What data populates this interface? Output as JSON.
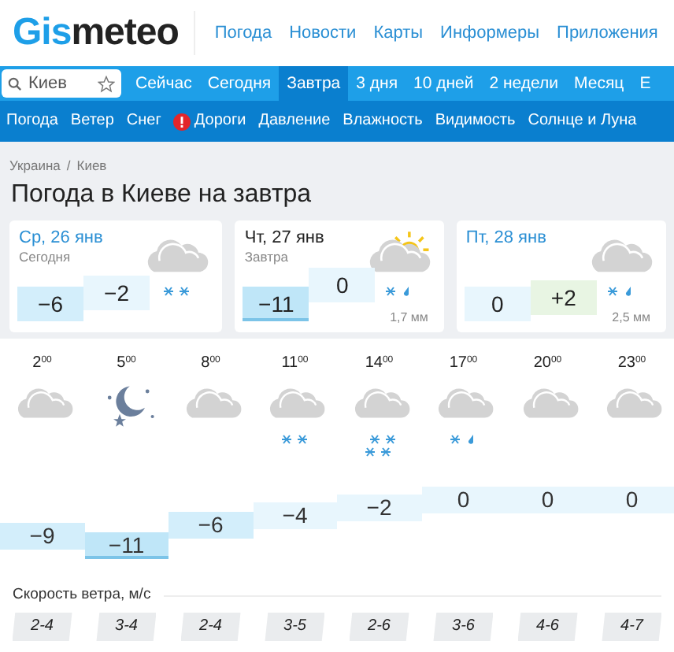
{
  "logo": {
    "part_1": "Gis",
    "part_2": "meteo"
  },
  "top_nav": [
    "Погода",
    "Новости",
    "Карты",
    "Информеры",
    "Приложения"
  ],
  "search": {
    "value": "Киев"
  },
  "period_tabs": [
    {
      "label": "Сейчас",
      "selected": false
    },
    {
      "label": "Сегодня",
      "selected": false
    },
    {
      "label": "Завтра",
      "selected": true
    },
    {
      "label": "3 дня",
      "selected": false
    },
    {
      "label": "10 дней",
      "selected": false
    },
    {
      "label": "2 недели",
      "selected": false
    },
    {
      "label": "Месяц",
      "selected": false
    },
    {
      "label": "Е",
      "selected": false
    }
  ],
  "param_tabs": [
    {
      "label": "Погода",
      "alert": false
    },
    {
      "label": "Ветер",
      "alert": false
    },
    {
      "label": "Снег",
      "alert": false
    },
    {
      "label": "Дороги",
      "alert": true
    },
    {
      "label": "Давление",
      "alert": false
    },
    {
      "label": "Влажность",
      "alert": false
    },
    {
      "label": "Видимость",
      "alert": false
    },
    {
      "label": "Солнце и Луна",
      "alert": false
    }
  ],
  "breadcrumb": {
    "parts": [
      "Украина",
      "Киев"
    ],
    "separator": "/"
  },
  "title": "Погода в Киеве на завтра",
  "days": [
    {
      "date": "Ср, 26 янв",
      "subtitle": "Сегодня",
      "min": "−6",
      "max": "−2",
      "kind": "cloud",
      "precipitation": {
        "kind": "snow"
      },
      "selected": false
    },
    {
      "date": "Чт, 27 янв",
      "subtitle": "Завтра",
      "min": "−11",
      "max": "0",
      "kind": "cloud-sun",
      "precipitation": {
        "kind": "snow-rain"
      },
      "amount": "1,7 мм",
      "selected": true
    },
    {
      "date": "Пт, 28 янв",
      "min": "0",
      "max": "+2",
      "kind": "cloud",
      "precipitation": {
        "kind": "snow-rain"
      },
      "amount": "2,5 мм",
      "selected": false
    }
  ],
  "hours": [
    {
      "hour": "2",
      "minutes": "00",
      "kind": "cloud",
      "temp": "−9",
      "wind": "2-4"
    },
    {
      "hour": "5",
      "minutes": "00",
      "kind": "moon",
      "temp": "−11",
      "wind": "3-4"
    },
    {
      "hour": "8",
      "minutes": "00",
      "kind": "cloud",
      "temp": "−6",
      "wind": "2-4"
    },
    {
      "hour": "11",
      "minutes": "00",
      "kind": "cloud",
      "precipitation": {
        "kind": "snow"
      },
      "temp": "−4",
      "wind": "3-5"
    },
    {
      "hour": "14",
      "minutes": "00",
      "kind": "cloud",
      "precipitation": {
        "kind": "heavy-snow"
      },
      "temp": "−2",
      "wind": "2-6"
    },
    {
      "hour": "17",
      "minutes": "00",
      "kind": "cloud",
      "precipitation": {
        "kind": "snow-rain"
      },
      "temp": "0",
      "wind": "3-6"
    },
    {
      "hour": "20",
      "minutes": "00",
      "kind": "cloud",
      "temp": "0",
      "wind": "4-6"
    },
    {
      "hour": "23",
      "minutes": "00",
      "kind": "cloud",
      "temp": "0",
      "wind": "4-7"
    }
  ],
  "wind_label": "Скорость ветра, м/с"
}
